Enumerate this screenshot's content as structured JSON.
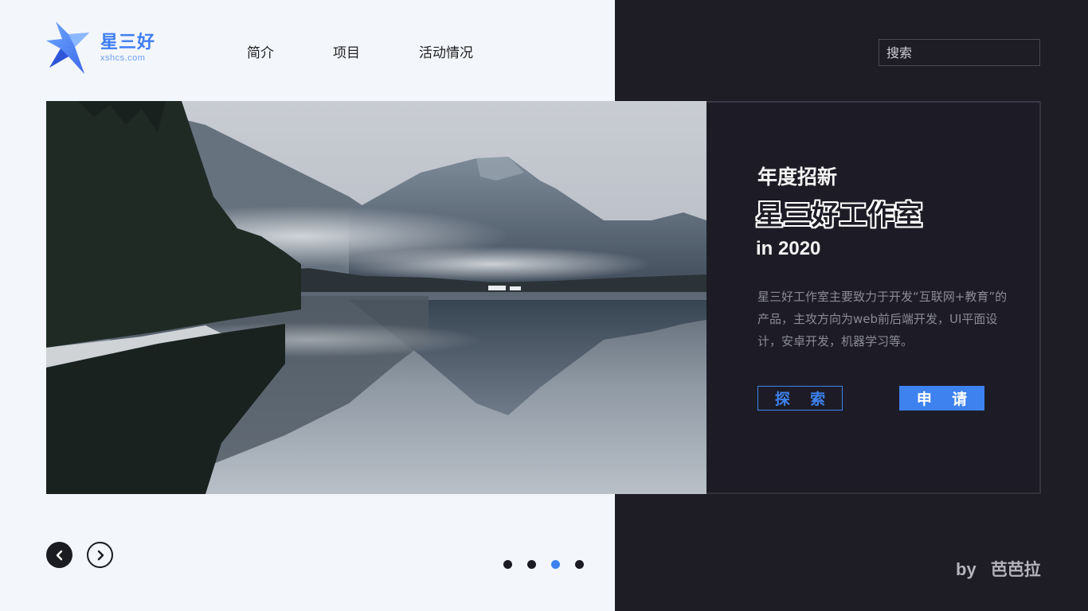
{
  "brand": {
    "name": "星三好",
    "domain": "xshcs.com",
    "accent": "#3f7df3"
  },
  "nav": {
    "items": [
      "简介",
      "项目",
      "活动情况"
    ]
  },
  "search": {
    "placeholder": "搜索"
  },
  "hero": {
    "kicker": "年度招新",
    "headline": "星三好工作室",
    "year": "in 2020",
    "description": "星三好工作室主要致力于开发“互联网+教育”的产品，主攻方向为web前后端开发，UI平面设计，安卓开发，机器学习等。",
    "buttons": {
      "explore": "探 索",
      "apply": "申 请"
    }
  },
  "carousel": {
    "slide_count": 4,
    "active_index": 2
  },
  "credit": {
    "by": "by",
    "author": "芭芭拉"
  },
  "colors": {
    "accent": "#3d82ef",
    "dark": "#1e1d26",
    "light": "#f3f6fb"
  }
}
